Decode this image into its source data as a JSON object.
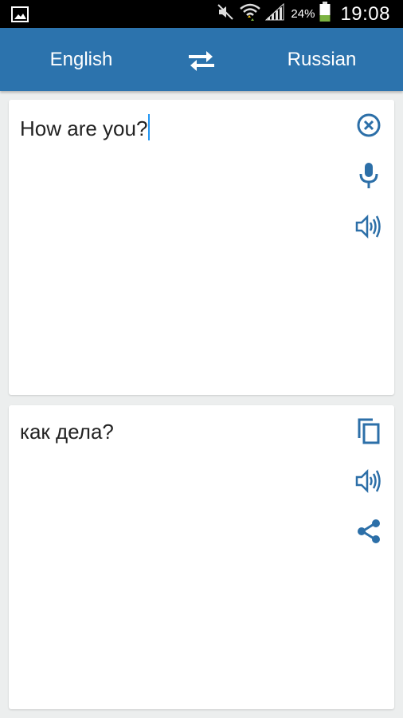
{
  "status_bar": {
    "battery_percent": "24%",
    "time": "19:08"
  },
  "app_bar": {
    "source_language": "English",
    "target_language": "Russian"
  },
  "source": {
    "text": "How are you?"
  },
  "translation": {
    "text": "как дела?"
  },
  "icons": {
    "gallery": "gallery-icon",
    "mute": "vibrate-mute-icon",
    "wifi": "wifi-icon",
    "signal": "signal-icon",
    "battery": "battery-icon",
    "swap": "swap-icon",
    "clear": "close-circle-icon",
    "mic": "microphone-icon",
    "speaker": "speaker-icon",
    "copy": "copy-icon",
    "share": "share-icon"
  },
  "colors": {
    "primary": "#2c73ad",
    "icon": "#2c6fa8",
    "caret": "#2196f3",
    "battery": "#7cb342"
  }
}
